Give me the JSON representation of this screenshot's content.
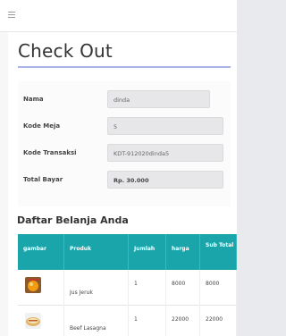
{
  "header": {
    "menu_icon": "hamburger-icon"
  },
  "page": {
    "title": "Check Out"
  },
  "form": {
    "nama_label": "Nama",
    "nama_value": "dinda",
    "kode_meja_label": "Kode Meja",
    "kode_meja_value": "5",
    "kode_transaksi_label": "Kode Transaksi",
    "kode_transaksi_value": "KDT-912020dinda5",
    "total_bayar_label": "Total Bayar",
    "total_bayar_value": "Rp. 30.000"
  },
  "cart": {
    "title": "Daftar Belanja Anda",
    "headers": [
      "gambar",
      "Produk",
      "Jumlah",
      "harga",
      "Sub Total"
    ],
    "rows": [
      {
        "image": "juice-product-image",
        "produk": "Jus Jeruk",
        "jumlah": "1",
        "harga": "8000",
        "subtotal": "8000"
      },
      {
        "image": "food-product-image",
        "produk": "Beef Lasagna",
        "jumlah": "1",
        "harga": "22000",
        "subtotal": "22000"
      }
    ]
  },
  "colors": {
    "table_header": "#1aa5ab",
    "title_underline": "#a9b3e6"
  }
}
